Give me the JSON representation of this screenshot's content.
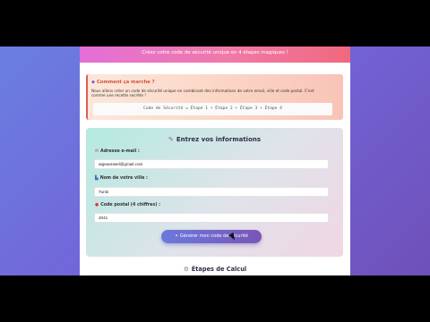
{
  "hero": {
    "subtitle": "Créez votre code de sécurité unique en 4 étapes magiques !"
  },
  "howto": {
    "icon": "question-icon",
    "title": "Comment ça marche ?",
    "text": "Nous allons créer un code de sécurité unique en combinant des informations de votre email, ville et code postal. C'est comme une recette secrète !",
    "formula": "Code de Sécurité = Étape 1 + Étape 2 + Étape 3 + Étape 4"
  },
  "form": {
    "icon": "pencil-icon",
    "title": "Entrez vos informations",
    "email": {
      "icon": "email-icon",
      "label": "Adresse e-mail :",
      "value": "aigeaarasel@gmail.com"
    },
    "city": {
      "icon": "city-icon",
      "label": "Nom de votre ville :",
      "value": "Tunis"
    },
    "postal": {
      "icon": "pin-icon",
      "label": "Code postal (4 chiffres) :",
      "value": "2041"
    },
    "submit": {
      "icon": "sparkle-icon",
      "label": "Générer mon code de sécurité"
    }
  },
  "steps": {
    "icon": "gear-icon",
    "title": "Étapes de Calcul"
  }
}
